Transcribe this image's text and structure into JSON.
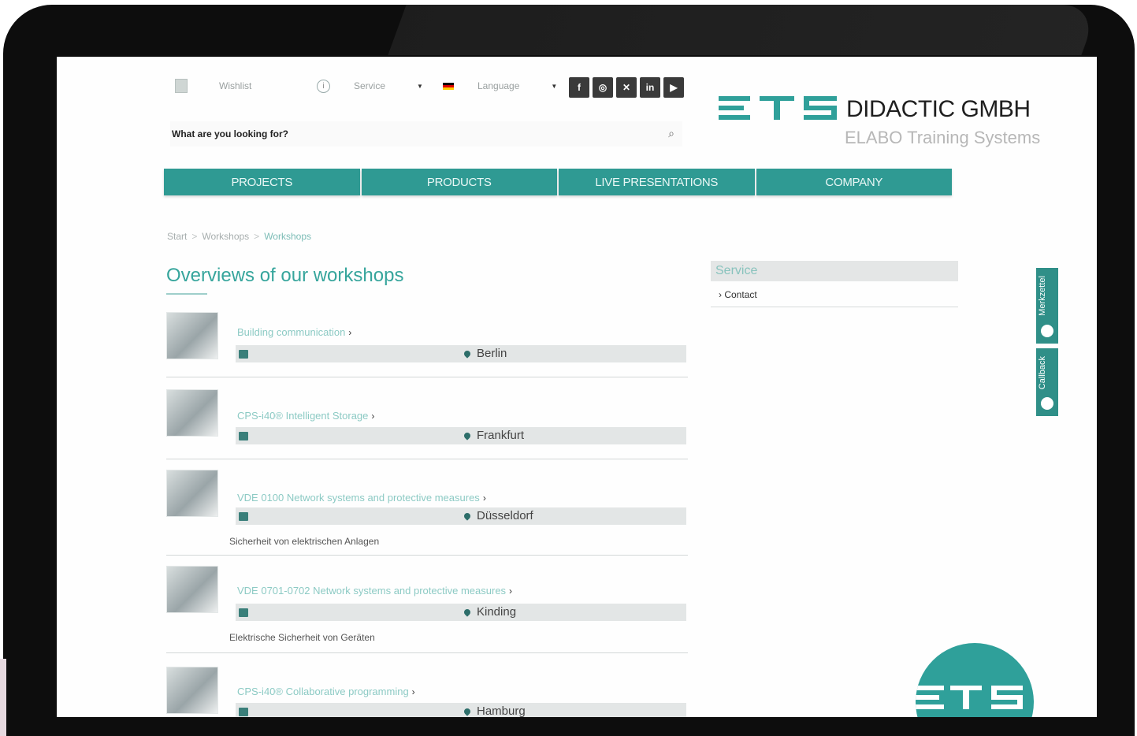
{
  "topbar": {
    "wishlist_label": "Wishlist",
    "service_label": "Service",
    "language_label": "Language",
    "social_icons": [
      "facebook-icon",
      "instagram-icon",
      "xing-icon",
      "linkedin-icon",
      "youtube-icon"
    ]
  },
  "search": {
    "placeholder": "What are you looking for?"
  },
  "logo": {
    "name": "DIDACTIC GMBH",
    "tagline": "ELABO Training Systems"
  },
  "nav": {
    "items": [
      "PROJECTS",
      "PRODUCTS",
      "LIVE PRESENTATIONS",
      "COMPANY"
    ]
  },
  "breadcrumb": [
    "Start",
    "Workshops",
    "Workshops"
  ],
  "page_title": "Overviews of our workshops",
  "workshops": [
    {
      "title": "Building communication",
      "location": "Berlin",
      "description": ""
    },
    {
      "title": "CPS-i40® Intelligent Storage",
      "location": "Frankfurt",
      "description": ""
    },
    {
      "title": "VDE 0100 Network systems and protective measures",
      "location": "Düsseldorf",
      "description": "Sicherheit von elektrischen Anlagen"
    },
    {
      "title": "VDE 0701-0702 Network systems and protective measures",
      "location": "Kinding",
      "description": "Elektrische Sicherheit von Geräten"
    },
    {
      "title": "CPS-i40® Collaborative programming",
      "location": "Hamburg",
      "description": ""
    }
  ],
  "sidebar": {
    "heading": "Service",
    "items": [
      "Contact"
    ]
  },
  "side_tabs": [
    "Merkzettel",
    "Callback"
  ],
  "colors": {
    "brand_teal": "#2f9a93",
    "link_teal": "#8ccac4",
    "heading_teal": "#36a59c"
  }
}
